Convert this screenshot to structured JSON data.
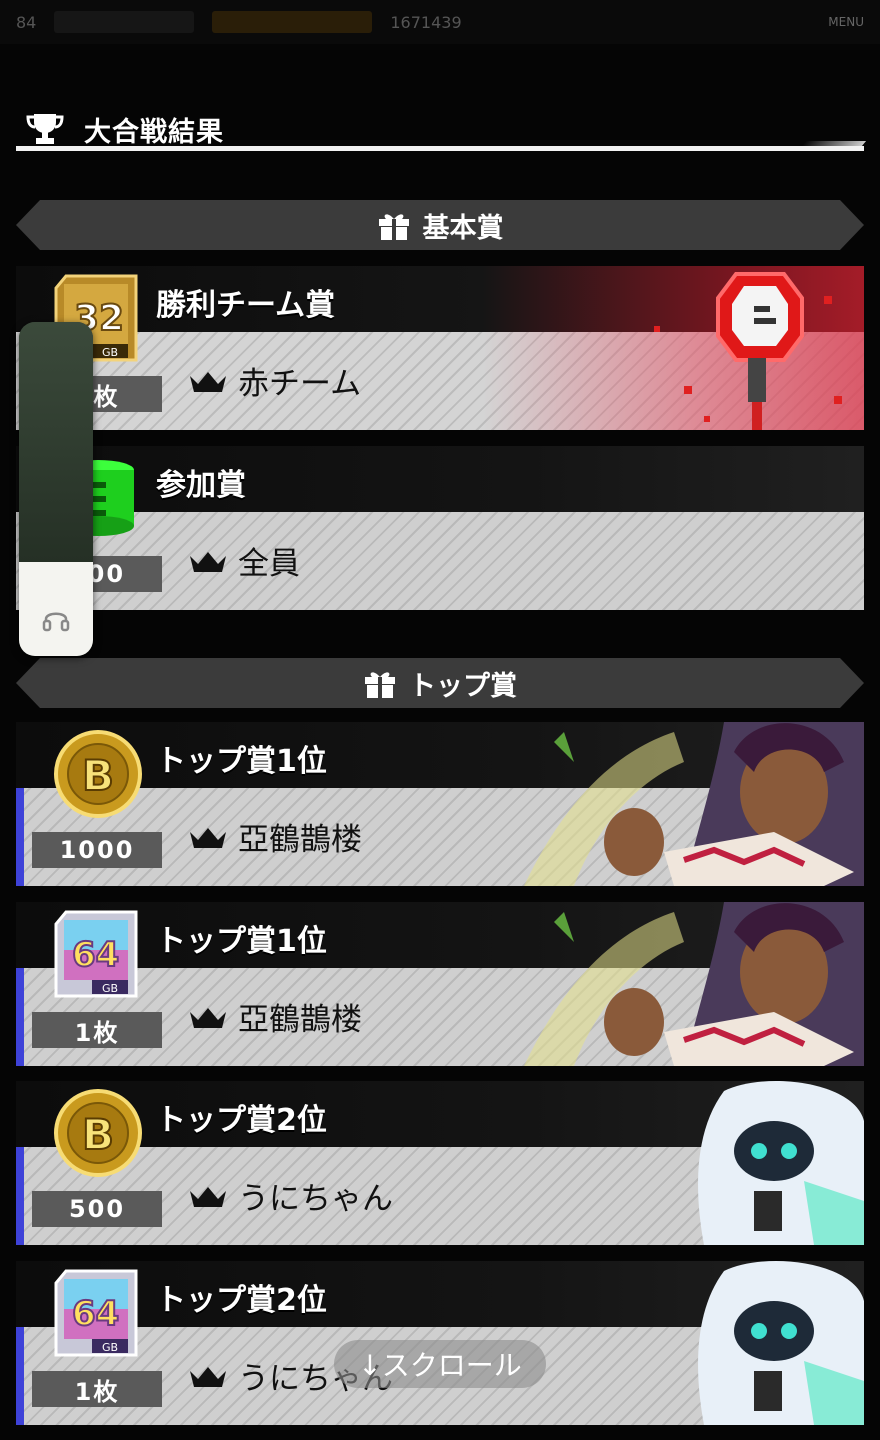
{
  "status_bar": {
    "level": "84",
    "coins": "1671439",
    "menu_label": "MENU"
  },
  "section": {
    "title": "大合戦結果",
    "icon": "trophy-icon"
  },
  "groups": [
    {
      "label": "基本賞",
      "icon": "gift-icon"
    },
    {
      "label": "トップ賞",
      "icon": "gift-icon"
    }
  ],
  "prizes": [
    {
      "name": "勝利チーム賞",
      "winner": "赤チーム",
      "count": "1枚",
      "item": "32GB-card"
    },
    {
      "name": "参加賞",
      "winner": "全員",
      "count": "500",
      "item": "green-chip-stack"
    },
    {
      "name": "トップ賞1位",
      "winner": "亞鶴鵲楼",
      "count": "1000",
      "item": "gold-b-coin"
    },
    {
      "name": "トップ賞1位",
      "winner": "亞鶴鵲楼",
      "count": "1枚",
      "item": "64GB-card"
    },
    {
      "name": "トップ賞2位",
      "winner": "うにちゃん",
      "count": "500",
      "item": "gold-b-coin"
    },
    {
      "name": "トップ賞2位",
      "winner": "うにちゃん",
      "count": "1枚",
      "item": "64GB-card"
    }
  ],
  "card_labels": {
    "gb32": "32",
    "gb64": "64",
    "gb": "GB",
    "coin": "B"
  },
  "volume": {
    "level": 0.28,
    "icon": "headphones-icon"
  },
  "scroll_hint": "↓スクロール",
  "colors": {
    "accent_blue": "#3e42d8",
    "red_team": "#c0202c",
    "banner": "#3b3b3b"
  }
}
